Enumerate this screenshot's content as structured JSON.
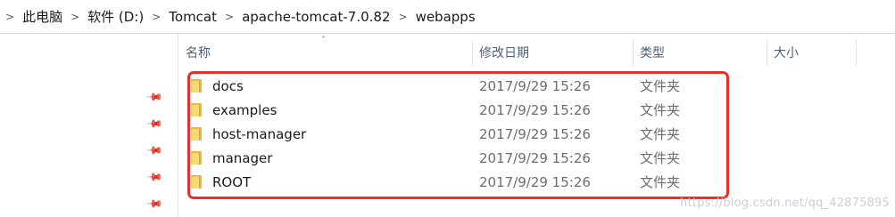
{
  "breadcrumb": {
    "items": [
      "此电脑",
      "软件 (D:)",
      "Tomcat",
      "apache-tomcat-7.0.82",
      "webapps"
    ],
    "separator": ">"
  },
  "columns": {
    "name": "名称",
    "modified": "修改日期",
    "type": "类型",
    "size": "大小"
  },
  "files": [
    {
      "name": "docs",
      "modified": "2017/9/29 15:26",
      "type": "文件夹"
    },
    {
      "name": "examples",
      "modified": "2017/9/29 15:26",
      "type": "文件夹"
    },
    {
      "name": "host-manager",
      "modified": "2017/9/29 15:26",
      "type": "文件夹"
    },
    {
      "name": "manager",
      "modified": "2017/9/29 15:26",
      "type": "文件夹"
    },
    {
      "name": "ROOT",
      "modified": "2017/9/29 15:26",
      "type": "文件夹"
    }
  ],
  "colors": {
    "highlight": "#e5312b",
    "folder": "#f8d775",
    "header_text": "#4c607a"
  },
  "icons": {
    "sort": "chevron-up-icon",
    "folder": "folder-icon",
    "pin": "pin-icon",
    "separator": "chevron-right-icon"
  },
  "watermark": "https://blog.csdn.net/qq_42875895"
}
